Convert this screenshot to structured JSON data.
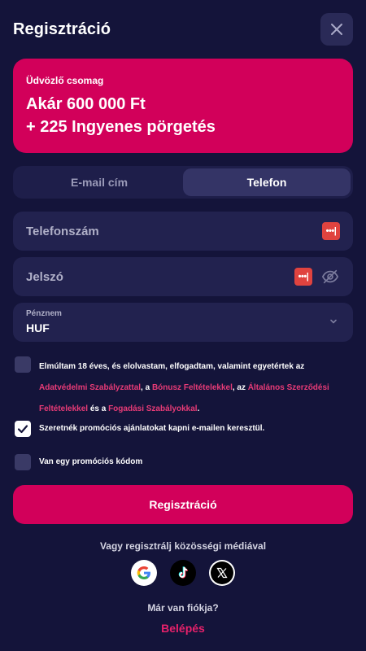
{
  "header": {
    "title": "Regisztráció"
  },
  "promo": {
    "label": "Üdvözlő csomag",
    "line1": "Akár 600 000 Ft",
    "line2": "+ 225 Ingyenes pörgetés"
  },
  "tabs": [
    {
      "label": "E-mail cím",
      "active": false
    },
    {
      "label": "Telefon",
      "active": true
    }
  ],
  "form": {
    "phone_placeholder": "Telefonszám",
    "password_placeholder": "Jelszó",
    "password_manager_glyph": "•••|",
    "currency_label": "Pénznem",
    "currency_value": "HUF"
  },
  "consent": {
    "part1": "Elmúltam 18 éves, és elolvastam, elfogadtam, valamint egyetértek az",
    "link1": "Adatvédelmi Szabályzattal",
    "part2": ", a",
    "link2": "Bónusz Feltételekkel",
    "part3": ", az",
    "link3": "Általános Szerződési Feltételekkel",
    "part4": "és a",
    "link4": "Fogadási Szabályokkal",
    "part5": ".",
    "checked": false
  },
  "promo_emails": {
    "label": "Szeretnék promóciós ajánlatokat kapni e-mailen keresztül.",
    "checked": true
  },
  "promo_code": {
    "label": "Van egy promóciós kódom",
    "checked": false
  },
  "buttons": {
    "register": "Regisztráció"
  },
  "social": {
    "title": "Vagy regisztrálj közösségi médiával",
    "items": [
      "google-icon",
      "tiktok-icon",
      "x-icon"
    ]
  },
  "footer": {
    "question": "Már van fiókja?",
    "login": "Belépés"
  },
  "colors": {
    "background": "#14143a",
    "accent": "#d2005a",
    "field": "#22224f",
    "link": "#e83b77"
  }
}
